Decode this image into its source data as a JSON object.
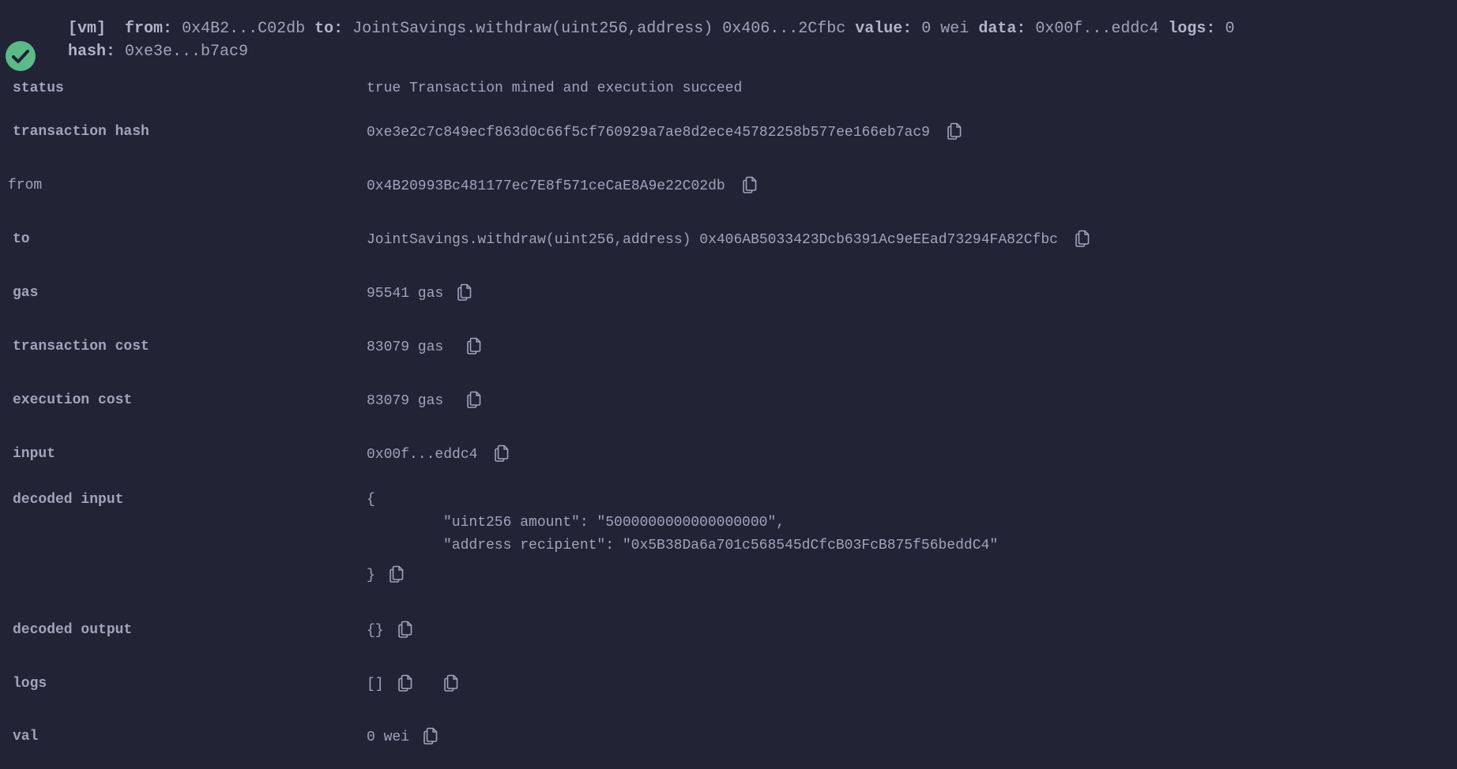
{
  "header": {
    "tag": "[vm]",
    "from_label": "from:",
    "from_value": "0x4B2...C02db",
    "to_label": "to:",
    "to_value": "JointSavings.withdraw(uint256,address) 0x406...2Cfbc",
    "value_label": "value:",
    "value_value": "0 wei",
    "data_label": "data:",
    "data_value": "0x00f...eddc4",
    "logs_label": "logs:",
    "logs_value": "0",
    "hash_label": "hash:",
    "hash_value": "0xe3e...b7ac9",
    "status_icon": "check-circle-icon",
    "status_color": "#5bba88"
  },
  "rows": {
    "status": {
      "label": "status",
      "value": "true Transaction mined and execution succeed"
    },
    "transaction_hash": {
      "label": "transaction hash",
      "value": "0xe3e2c7c849ecf863d0c66f5cf760929a7ae8d2ece45782258b577ee166eb7ac9"
    },
    "from": {
      "label": "from",
      "value": "0x4B20993Bc481177ec7E8f571ceCaE8A9e22C02db"
    },
    "to": {
      "label": "to",
      "value": "JointSavings.withdraw(uint256,address) 0x406AB5033423Dcb6391Ac9eEEad73294FA82Cfbc"
    },
    "gas": {
      "label": "gas",
      "value": "95541 gas"
    },
    "transaction_cost": {
      "label": "transaction cost",
      "value": "83079 gas"
    },
    "execution_cost": {
      "label": "execution cost",
      "value": "83079 gas"
    },
    "input": {
      "label": "input",
      "value": "0x00f...eddc4"
    },
    "decoded_input": {
      "label": "decoded input",
      "open": "{",
      "line1": "\"uint256 amount\": \"5000000000000000000\",",
      "line2": "\"address recipient\": \"0x5B38Da6a701c568545dCfcB03FcB875f56beddC4\"",
      "close": "}"
    },
    "decoded_output": {
      "label": "decoded output",
      "value": "{}"
    },
    "logs": {
      "label": "logs",
      "value": "[]"
    },
    "val": {
      "label": "val",
      "value": "0 wei"
    }
  },
  "icons": {
    "copy": "copy-icon"
  }
}
